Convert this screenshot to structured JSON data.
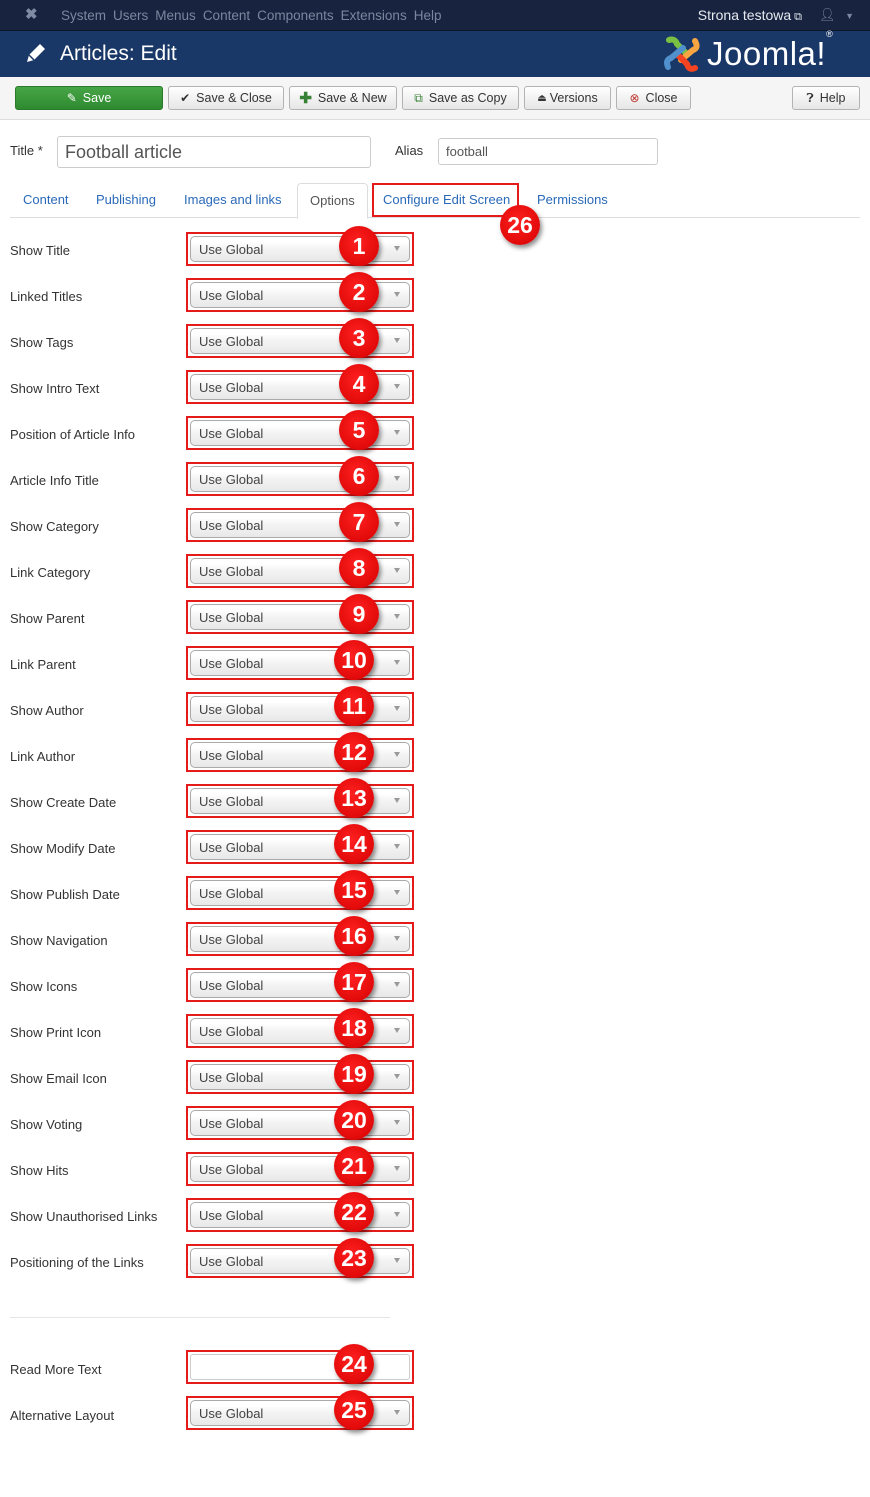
{
  "navbar": {
    "menu": [
      "System",
      "Users",
      "Menus",
      "Content",
      "Components",
      "Extensions",
      "Help"
    ],
    "site_link": "Strona testowa",
    "icons": {
      "logo": "joomla-icon",
      "external": "external-link-icon",
      "user": "user-icon",
      "caret": "caret-down-icon"
    }
  },
  "header": {
    "title": "Articles: Edit",
    "brand": "Joomla!",
    "brand_mark": "®"
  },
  "toolbar": {
    "save": "Save",
    "save_close": "Save & Close",
    "save_new": "Save & New",
    "save_copy": "Save as Copy",
    "versions": "Versions",
    "close": "Close",
    "help": "Help"
  },
  "form": {
    "title_label": "Title *",
    "title_value": "Football article",
    "alias_label": "Alias",
    "alias_value": "football"
  },
  "tabs": [
    "Content",
    "Publishing",
    "Images and links",
    "Options",
    "Configure Edit Screen",
    "Permissions"
  ],
  "active_tab": "Options",
  "options": [
    {
      "label": "Show Title",
      "value": "Use Global",
      "badge": "1"
    },
    {
      "label": "Linked Titles",
      "value": "Use Global",
      "badge": "2"
    },
    {
      "label": "Show Tags",
      "value": "Use Global",
      "badge": "3"
    },
    {
      "label": "Show Intro Text",
      "value": "Use Global",
      "badge": "4"
    },
    {
      "label": "Position of Article Info",
      "value": "Use Global",
      "badge": "5"
    },
    {
      "label": "Article Info Title",
      "value": "Use Global",
      "badge": "6"
    },
    {
      "label": "Show Category",
      "value": "Use Global",
      "badge": "7"
    },
    {
      "label": "Link Category",
      "value": "Use Global",
      "badge": "8"
    },
    {
      "label": "Show Parent",
      "value": "Use Global",
      "badge": "9"
    },
    {
      "label": "Link Parent",
      "value": "Use Global",
      "badge": "10"
    },
    {
      "label": "Show Author",
      "value": "Use Global",
      "badge": "11"
    },
    {
      "label": "Link Author",
      "value": "Use Global",
      "badge": "12"
    },
    {
      "label": "Show Create Date",
      "value": "Use Global",
      "badge": "13"
    },
    {
      "label": "Show Modify Date",
      "value": "Use Global",
      "badge": "14"
    },
    {
      "label": "Show Publish Date",
      "value": "Use Global",
      "badge": "15"
    },
    {
      "label": "Show Navigation",
      "value": "Use Global",
      "badge": "16"
    },
    {
      "label": "Show Icons",
      "value": "Use Global",
      "badge": "17"
    },
    {
      "label": "Show Print Icon",
      "value": "Use Global",
      "badge": "18"
    },
    {
      "label": "Show Email Icon",
      "value": "Use Global",
      "badge": "19"
    },
    {
      "label": "Show Voting",
      "value": "Use Global",
      "badge": "20"
    },
    {
      "label": "Show Hits",
      "value": "Use Global",
      "badge": "21"
    },
    {
      "label": "Show Unauthorised Links",
      "value": "Use Global",
      "badge": "22"
    },
    {
      "label": "Positioning of the Links",
      "value": "Use Global",
      "badge": "23"
    }
  ],
  "extra": {
    "read_more_label": "Read More Text",
    "read_more_value": "",
    "read_more_badge": "24",
    "alt_layout_label": "Alternative Layout",
    "alt_layout_value": "Use Global",
    "alt_layout_badge": "25"
  },
  "tab_badge": "26",
  "colors": {
    "annotation": "#e51b1b",
    "save_button": "#3d9a3d",
    "header_bg": "#1a3867",
    "navbar_bg": "#17233f",
    "link": "#2a69b8"
  }
}
